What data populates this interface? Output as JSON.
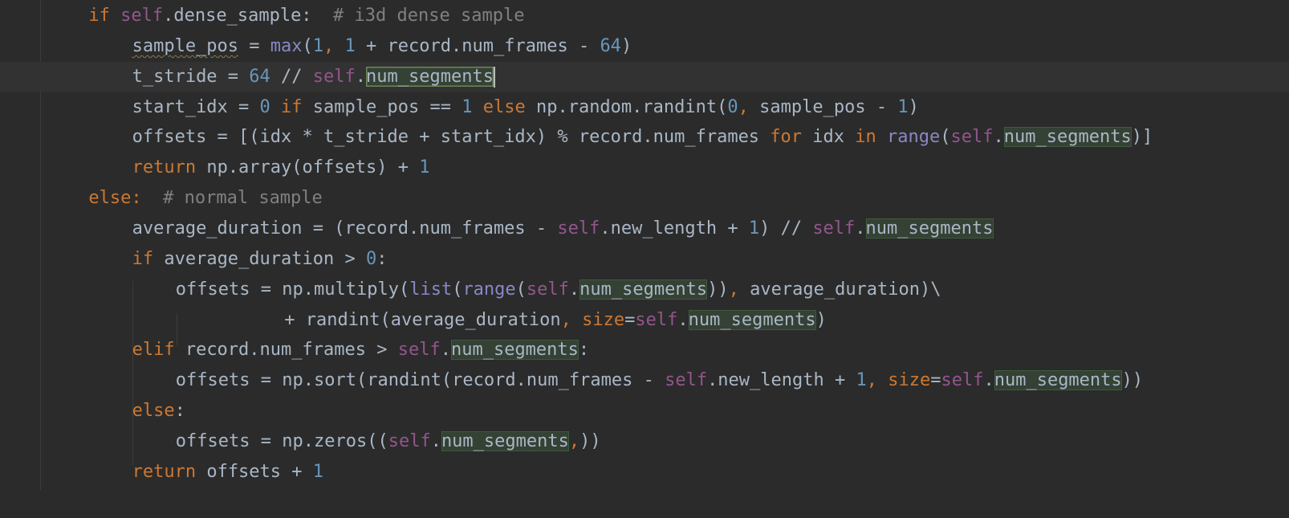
{
  "editor": {
    "language": "python",
    "theme_colors": {
      "background": "#2b2b2b",
      "current_line": "#323232",
      "keyword": "#cc7832",
      "self": "#94558d",
      "number": "#6897bb",
      "builtin": "#8888c6",
      "comment": "#808080",
      "text": "#a9b7c6",
      "highlight": "#344134"
    },
    "lines": [
      {
        "indent": 2,
        "tokens": [
          {
            "t": "if",
            "c": "kw"
          },
          {
            "t": " ",
            "c": "id"
          },
          {
            "t": "self",
            "c": "self"
          },
          {
            "t": ".dense_sample:",
            "c": "id"
          },
          {
            "t": "  # i3d dense sample",
            "c": "cm"
          }
        ]
      },
      {
        "indent": 3,
        "tokens": [
          {
            "t": "sample_pos",
            "c": "id",
            "warn": true
          },
          {
            "t": " = ",
            "c": "op"
          },
          {
            "t": "max",
            "c": "bi"
          },
          {
            "t": "(",
            "c": "op"
          },
          {
            "t": "1",
            "c": "num"
          },
          {
            "t": ", ",
            "c": "punc"
          },
          {
            "t": "1",
            "c": "num"
          },
          {
            "t": " + record.num_frames - ",
            "c": "id"
          },
          {
            "t": "64",
            "c": "num"
          },
          {
            "t": ")",
            "c": "op"
          }
        ]
      },
      {
        "indent": 3,
        "current": true,
        "tokens": [
          {
            "t": "t_stride = ",
            "c": "id"
          },
          {
            "t": "64",
            "c": "num"
          },
          {
            "t": " // ",
            "c": "op"
          },
          {
            "t": "self",
            "c": "self"
          },
          {
            "t": ".",
            "c": "id"
          },
          {
            "t": "num_segments",
            "c": "hl",
            "sel": true
          },
          {
            "t": "",
            "c": "caret"
          }
        ]
      },
      {
        "indent": 3,
        "tokens": [
          {
            "t": "start_idx = ",
            "c": "id"
          },
          {
            "t": "0",
            "c": "num"
          },
          {
            "t": " ",
            "c": "id"
          },
          {
            "t": "if",
            "c": "kw"
          },
          {
            "t": " sample_pos == ",
            "c": "id"
          },
          {
            "t": "1",
            "c": "num"
          },
          {
            "t": " ",
            "c": "id"
          },
          {
            "t": "else",
            "c": "kw"
          },
          {
            "t": " np.random.randint(",
            "c": "id"
          },
          {
            "t": "0",
            "c": "num"
          },
          {
            "t": ", ",
            "c": "punc"
          },
          {
            "t": "sample_pos - ",
            "c": "id"
          },
          {
            "t": "1",
            "c": "num"
          },
          {
            "t": ")",
            "c": "op"
          }
        ]
      },
      {
        "indent": 3,
        "tokens": [
          {
            "t": "offsets = [(idx * t_stride + start_idx) % record.num_frames ",
            "c": "id"
          },
          {
            "t": "for",
            "c": "kw"
          },
          {
            "t": " idx ",
            "c": "id"
          },
          {
            "t": "in",
            "c": "kw"
          },
          {
            "t": " ",
            "c": "id"
          },
          {
            "t": "range",
            "c": "bi"
          },
          {
            "t": "(",
            "c": "op"
          },
          {
            "t": "self",
            "c": "self"
          },
          {
            "t": ".",
            "c": "id"
          },
          {
            "t": "num_segments",
            "c": "hl"
          },
          {
            "t": ")]",
            "c": "op"
          }
        ]
      },
      {
        "indent": 3,
        "tokens": [
          {
            "t": "return",
            "c": "kw"
          },
          {
            "t": " np.array(offsets) + ",
            "c": "id"
          },
          {
            "t": "1",
            "c": "num"
          }
        ]
      },
      {
        "indent": 2,
        "tokens": [
          {
            "t": "else",
            "c": "kw"
          },
          {
            "t": ":",
            "c": "punc"
          },
          {
            "t": "  # normal sample",
            "c": "cm"
          }
        ]
      },
      {
        "indent": 3,
        "tokens": [
          {
            "t": "average_duration = (record.num_frames - ",
            "c": "id"
          },
          {
            "t": "self",
            "c": "self"
          },
          {
            "t": ".new_length + ",
            "c": "id"
          },
          {
            "t": "1",
            "c": "num"
          },
          {
            "t": ") // ",
            "c": "op"
          },
          {
            "t": "self",
            "c": "self"
          },
          {
            "t": ".",
            "c": "id"
          },
          {
            "t": "num_segments",
            "c": "hl"
          }
        ]
      },
      {
        "indent": 3,
        "tokens": [
          {
            "t": "if",
            "c": "kw"
          },
          {
            "t": " average_duration > ",
            "c": "id"
          },
          {
            "t": "0",
            "c": "num"
          },
          {
            "t": ":",
            "c": "op"
          }
        ]
      },
      {
        "indent": 4,
        "tokens": [
          {
            "t": "offsets = np.multiply(",
            "c": "id"
          },
          {
            "t": "list",
            "c": "bi"
          },
          {
            "t": "(",
            "c": "op"
          },
          {
            "t": "range",
            "c": "bi"
          },
          {
            "t": "(",
            "c": "op"
          },
          {
            "t": "self",
            "c": "self"
          },
          {
            "t": ".",
            "c": "id"
          },
          {
            "t": "num_segments",
            "c": "hl"
          },
          {
            "t": "))",
            "c": "op"
          },
          {
            "t": ", ",
            "c": "punc"
          },
          {
            "t": "average_duration)\\",
            "c": "id"
          }
        ]
      },
      {
        "indent": 6.5,
        "tokens": [
          {
            "t": "+ randint(average_duration",
            "c": "id"
          },
          {
            "t": ", ",
            "c": "punc"
          },
          {
            "t": "size",
            "c": "param"
          },
          {
            "t": "=",
            "c": "op"
          },
          {
            "t": "self",
            "c": "self"
          },
          {
            "t": ".",
            "c": "id"
          },
          {
            "t": "num_segments",
            "c": "hl"
          },
          {
            "t": ")",
            "c": "op"
          }
        ]
      },
      {
        "indent": 3,
        "tokens": [
          {
            "t": "elif",
            "c": "kw"
          },
          {
            "t": " record.num_frames > ",
            "c": "id"
          },
          {
            "t": "self",
            "c": "self"
          },
          {
            "t": ".",
            "c": "id"
          },
          {
            "t": "num_segments",
            "c": "hl"
          },
          {
            "t": ":",
            "c": "op"
          }
        ]
      },
      {
        "indent": 4,
        "tokens": [
          {
            "t": "offsets = np.sort(randint(record.num_frames - ",
            "c": "id"
          },
          {
            "t": "self",
            "c": "self"
          },
          {
            "t": ".new_length + ",
            "c": "id"
          },
          {
            "t": "1",
            "c": "num"
          },
          {
            "t": ", ",
            "c": "punc"
          },
          {
            "t": "size",
            "c": "param"
          },
          {
            "t": "=",
            "c": "op"
          },
          {
            "t": "self",
            "c": "self"
          },
          {
            "t": ".",
            "c": "id"
          },
          {
            "t": "num_segments",
            "c": "hl"
          },
          {
            "t": "))",
            "c": "op"
          }
        ]
      },
      {
        "indent": 3,
        "tokens": [
          {
            "t": "else",
            "c": "kw"
          },
          {
            "t": ":",
            "c": "op"
          }
        ]
      },
      {
        "indent": 4,
        "tokens": [
          {
            "t": "offsets = np.zeros((",
            "c": "id"
          },
          {
            "t": "self",
            "c": "self"
          },
          {
            "t": ".",
            "c": "id"
          },
          {
            "t": "num_segments",
            "c": "hl"
          },
          {
            "t": ",",
            "c": "punc"
          },
          {
            "t": "))",
            "c": "op"
          }
        ]
      },
      {
        "indent": 3,
        "tokens": [
          {
            "t": "return",
            "c": "kw"
          },
          {
            "t": " offsets + ",
            "c": "id"
          },
          {
            "t": "1",
            "c": "num"
          }
        ]
      }
    ]
  }
}
